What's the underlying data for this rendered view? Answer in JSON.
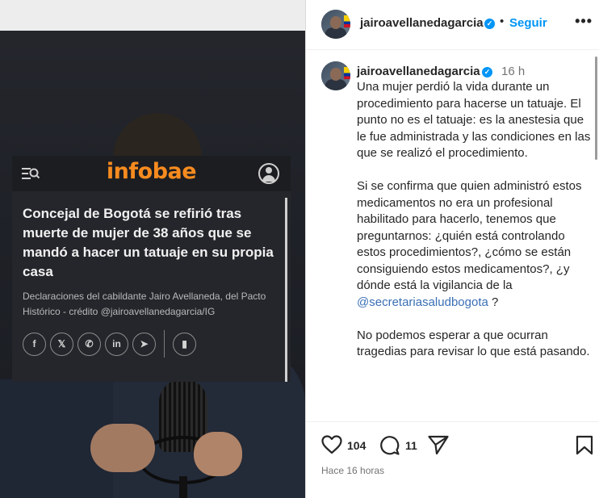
{
  "media": {
    "card": {
      "logo": "infobae",
      "headline": "Concejal de Bogotá se refirió tras muerte de mujer de 38 años que se mandó a hacer un tatuaje en su propia casa",
      "caption": "Declaraciones del cabildante Jairo Avellaneda, del Pacto Histórico - crédito @jairoavellanedagarcia/IG",
      "share_icons": [
        "facebook-icon",
        "x-icon",
        "whatsapp-icon",
        "linkedin-icon",
        "telegram-icon",
        "bookmark-icon"
      ],
      "share_glyphs": [
        "f",
        "𝕏",
        "✆",
        "in",
        "➤",
        "▮"
      ],
      "logo_color": "#f68b1f"
    }
  },
  "post": {
    "header": {
      "username": "jairoavellanedagarcia",
      "verified_glyph": "✓",
      "separator": "•",
      "follow_label": "Seguir",
      "more_glyph": "•••"
    },
    "caption": {
      "username": "jairoavellanedagarcia",
      "time": "16 h",
      "paragraph1": "Una mujer perdió la vida durante un procedimiento para hacerse un tatuaje. El punto no es el tatuaje: es la anestesia que le fue administrada y las condiciones en las que se realizó el procedimiento.",
      "paragraph2_before": "Si se confirma que quien administró estos medicamentos no era un profesional habilitado para hacerlo, tenemos que preguntarnos: ¿quién está controlando estos procedimientos?, ¿cómo se están consiguiendo estos medicamentos?, ¿y dónde está la vigilancia de la ",
      "paragraph2_mention": "@secretariasaludbogota",
      "paragraph2_after": " ?",
      "paragraph3": "No podemos esperar a que ocurran tragedias para revisar lo que está pasando."
    },
    "actions": {
      "likes": "104",
      "comments": "11",
      "time_ago": "Hace 16 horas"
    },
    "colors": {
      "accent": "#0095f6",
      "mention": "#3a6fb5",
      "muted": "#737373"
    }
  }
}
